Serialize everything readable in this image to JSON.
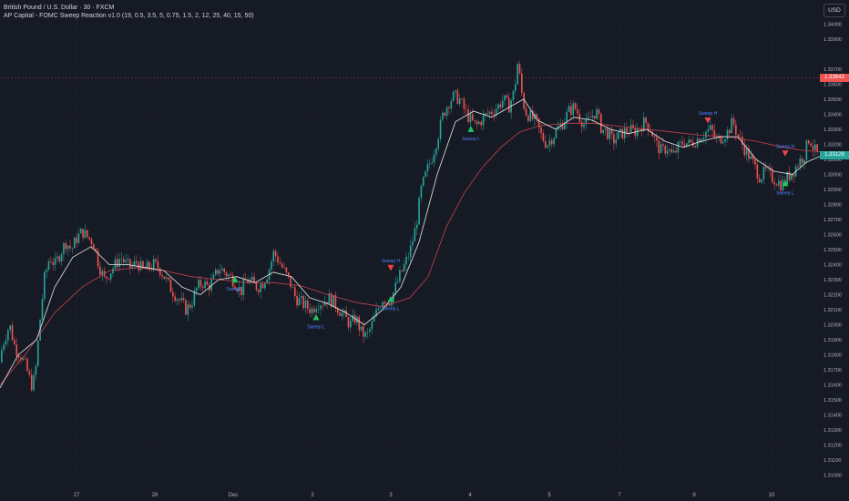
{
  "header": {
    "symbol": "British Pound / U.S. Dollar · 30 · FXCM",
    "indicator": "AP Capital - FOMC Sweep Reaction v1.0 (19, 0.5, 3.5, 5, 0.75, 1.5, 2, 12, 25, 40, 15, 50)"
  },
  "currency_button": "USD",
  "colors": {
    "background": "#161a25",
    "up": "#26a69a",
    "down": "#ef5350",
    "fast_ma": "#e8e8e8",
    "slow_ma": "#c2424c",
    "sweep_label": "#4d82ff",
    "grid": "#1e222d"
  },
  "chart_data": {
    "type": "line",
    "y_ticks": [
      "1.34000",
      "1.33900",
      "1.33700",
      "1.33600",
      "1.33500",
      "1.33400",
      "1.33300",
      "1.33200",
      "1.33100",
      "1.33000",
      "1.32900",
      "1.32800",
      "1.32700",
      "1.32600",
      "1.32500",
      "1.32400",
      "1.32300",
      "1.32200",
      "1.32100",
      "1.32000",
      "1.31900",
      "1.31800",
      "1.31700",
      "1.31600",
      "1.31500",
      "1.31400",
      "1.31300",
      "1.31200",
      "1.31100",
      "1.31000"
    ],
    "ylim": [
      1.3095,
      1.3405
    ],
    "x_ticks": [
      "27",
      "28",
      "Dec",
      "2",
      "3",
      "4",
      "5",
      "7",
      "9",
      "10"
    ],
    "last_price": "1.33643",
    "last_price_value": 1.33643,
    "current_price": "1.33128",
    "current_price_value": 1.33128,
    "x_range": [
      0,
      900
    ],
    "price_path": [
      [
        0,
        1.3175
      ],
      [
        6,
        1.319
      ],
      [
        12,
        1.32
      ],
      [
        18,
        1.3185
      ],
      [
        24,
        1.318
      ],
      [
        30,
        1.3172
      ],
      [
        36,
        1.316
      ],
      [
        40,
        1.3165
      ],
      [
        45,
        1.32
      ],
      [
        50,
        1.323
      ],
      [
        56,
        1.3245
      ],
      [
        62,
        1.324
      ],
      [
        68,
        1.3248
      ],
      [
        74,
        1.3255
      ],
      [
        80,
        1.325
      ],
      [
        86,
        1.3258
      ],
      [
        92,
        1.3262
      ],
      [
        98,
        1.3258
      ],
      [
        104,
        1.3255
      ],
      [
        110,
        1.324
      ],
      [
        116,
        1.323
      ],
      [
        122,
        1.3235
      ],
      [
        128,
        1.324
      ],
      [
        134,
        1.3245
      ],
      [
        140,
        1.324
      ],
      [
        146,
        1.3238
      ],
      [
        152,
        1.3242
      ],
      [
        158,
        1.3236
      ],
      [
        164,
        1.3238
      ],
      [
        170,
        1.324
      ],
      [
        176,
        1.3238
      ],
      [
        182,
        1.3232
      ],
      [
        188,
        1.3225
      ],
      [
        194,
        1.322
      ],
      [
        200,
        1.3215
      ],
      [
        206,
        1.321
      ],
      [
        212,
        1.3215
      ],
      [
        218,
        1.3225
      ],
      [
        224,
        1.3228
      ],
      [
        230,
        1.3225
      ],
      [
        236,
        1.323
      ],
      [
        242,
        1.3238
      ],
      [
        248,
        1.3235
      ],
      [
        254,
        1.3232
      ],
      [
        260,
        1.3228
      ],
      [
        266,
        1.3222
      ],
      [
        272,
        1.323
      ],
      [
        278,
        1.3228
      ],
      [
        284,
        1.3225
      ],
      [
        290,
        1.3228
      ],
      [
        296,
        1.3235
      ],
      [
        302,
        1.3248
      ],
      [
        308,
        1.3242
      ],
      [
        314,
        1.3235
      ],
      [
        320,
        1.3228
      ],
      [
        326,
        1.3218
      ],
      [
        332,
        1.3215
      ],
      [
        338,
        1.3212
      ],
      [
        344,
        1.321
      ],
      [
        350,
        1.3215
      ],
      [
        356,
        1.3215
      ],
      [
        362,
        1.3218
      ],
      [
        368,
        1.3215
      ],
      [
        374,
        1.321
      ],
      [
        380,
        1.3205
      ],
      [
        386,
        1.32
      ],
      [
        392,
        1.3205
      ],
      [
        398,
        1.3195
      ],
      [
        404,
        1.3192
      ],
      [
        410,
        1.32
      ],
      [
        416,
        1.321
      ],
      [
        422,
        1.3218
      ],
      [
        428,
        1.3215
      ],
      [
        434,
        1.3222
      ],
      [
        440,
        1.3232
      ],
      [
        446,
        1.324
      ],
      [
        452,
        1.325
      ],
      [
        458,
        1.3265
      ],
      [
        464,
        1.329
      ],
      [
        470,
        1.3302
      ],
      [
        476,
        1.3312
      ],
      [
        482,
        1.3325
      ],
      [
        488,
        1.334
      ],
      [
        494,
        1.3348
      ],
      [
        500,
        1.3352
      ],
      [
        506,
        1.335
      ],
      [
        512,
        1.3342
      ],
      [
        518,
        1.3336
      ],
      [
        524,
        1.3332
      ],
      [
        530,
        1.3336
      ],
      [
        536,
        1.334
      ],
      [
        542,
        1.3342
      ],
      [
        548,
        1.3345
      ],
      [
        554,
        1.335
      ],
      [
        560,
        1.3345
      ],
      [
        566,
        1.3355
      ],
      [
        570,
        1.3375
      ],
      [
        574,
        1.3355
      ],
      [
        578,
        1.3342
      ],
      [
        584,
        1.3338
      ],
      [
        590,
        1.3335
      ],
      [
        596,
        1.3325
      ],
      [
        602,
        1.332
      ],
      [
        608,
        1.3325
      ],
      [
        614,
        1.333
      ],
      [
        620,
        1.3335
      ],
      [
        626,
        1.3342
      ],
      [
        632,
        1.3345
      ],
      [
        638,
        1.3338
      ],
      [
        644,
        1.3332
      ],
      [
        650,
        1.3338
      ],
      [
        656,
        1.3342
      ],
      [
        662,
        1.333
      ],
      [
        668,
        1.3328
      ],
      [
        674,
        1.3322
      ],
      [
        680,
        1.3325
      ],
      [
        686,
        1.3328
      ],
      [
        692,
        1.333
      ],
      [
        698,
        1.3328
      ],
      [
        704,
        1.3332
      ],
      [
        710,
        1.3335
      ],
      [
        716,
        1.333
      ],
      [
        722,
        1.332
      ],
      [
        728,
        1.3315
      ],
      [
        734,
        1.3318
      ],
      [
        740,
        1.3312
      ],
      [
        746,
        1.3318
      ],
      [
        752,
        1.3322
      ],
      [
        758,
        1.332
      ],
      [
        764,
        1.3322
      ],
      [
        770,
        1.3325
      ],
      [
        776,
        1.3328
      ],
      [
        782,
        1.333
      ],
      [
        788,
        1.3322
      ],
      [
        794,
        1.3325
      ],
      [
        800,
        1.3328
      ],
      [
        806,
        1.3335
      ],
      [
        812,
        1.3325
      ],
      [
        818,
        1.3318
      ],
      [
        824,
        1.3312
      ],
      [
        830,
        1.3305
      ],
      [
        836,
        1.3298
      ],
      [
        842,
        1.3302
      ],
      [
        848,
        1.3298
      ],
      [
        854,
        1.3296
      ],
      [
        860,
        1.3293
      ],
      [
        866,
        1.3298
      ],
      [
        872,
        1.3302
      ],
      [
        878,
        1.3308
      ],
      [
        884,
        1.3312
      ],
      [
        890,
        1.3325
      ],
      [
        894,
        1.3318
      ],
      [
        900,
        1.3312
      ]
    ],
    "fast_ma": [
      [
        0,
        1.3158
      ],
      [
        20,
        1.318
      ],
      [
        40,
        1.319
      ],
      [
        60,
        1.3225
      ],
      [
        80,
        1.3245
      ],
      [
        100,
        1.3252
      ],
      [
        120,
        1.324
      ],
      [
        140,
        1.324
      ],
      [
        160,
        1.3238
      ],
      [
        180,
        1.3236
      ],
      [
        200,
        1.3225
      ],
      [
        220,
        1.322
      ],
      [
        240,
        1.323
      ],
      [
        260,
        1.3232
      ],
      [
        280,
        1.3228
      ],
      [
        300,
        1.3235
      ],
      [
        320,
        1.3232
      ],
      [
        340,
        1.3218
      ],
      [
        360,
        1.3214
      ],
      [
        380,
        1.3208
      ],
      [
        400,
        1.32
      ],
      [
        420,
        1.321
      ],
      [
        440,
        1.3225
      ],
      [
        460,
        1.3255
      ],
      [
        480,
        1.33
      ],
      [
        500,
        1.3335
      ],
      [
        520,
        1.3342
      ],
      [
        540,
        1.3338
      ],
      [
        560,
        1.3345
      ],
      [
        575,
        1.335
      ],
      [
        590,
        1.3336
      ],
      [
        610,
        1.333
      ],
      [
        630,
        1.3338
      ],
      [
        650,
        1.3336
      ],
      [
        670,
        1.333
      ],
      [
        690,
        1.3327
      ],
      [
        710,
        1.333
      ],
      [
        730,
        1.3322
      ],
      [
        750,
        1.3318
      ],
      [
        770,
        1.3322
      ],
      [
        790,
        1.3325
      ],
      [
        810,
        1.3325
      ],
      [
        830,
        1.331
      ],
      [
        850,
        1.3302
      ],
      [
        870,
        1.33
      ],
      [
        885,
        1.3308
      ],
      [
        900,
        1.3312
      ]
    ],
    "slow_ma": [
      [
        0,
        1.316
      ],
      [
        30,
        1.3182
      ],
      [
        60,
        1.3208
      ],
      [
        90,
        1.3225
      ],
      [
        120,
        1.3236
      ],
      [
        150,
        1.3238
      ],
      [
        180,
        1.3236
      ],
      [
        210,
        1.3232
      ],
      [
        240,
        1.323
      ],
      [
        270,
        1.3228
      ],
      [
        300,
        1.3228
      ],
      [
        330,
        1.3226
      ],
      [
        360,
        1.322
      ],
      [
        390,
        1.3215
      ],
      [
        420,
        1.3212
      ],
      [
        450,
        1.3218
      ],
      [
        470,
        1.3232
      ],
      [
        490,
        1.3265
      ],
      [
        510,
        1.3288
      ],
      [
        530,
        1.3305
      ],
      [
        550,
        1.3318
      ],
      [
        570,
        1.3328
      ],
      [
        590,
        1.3332
      ],
      [
        620,
        1.3334
      ],
      [
        650,
        1.3334
      ],
      [
        680,
        1.3332
      ],
      [
        710,
        1.333
      ],
      [
        740,
        1.3328
      ],
      [
        770,
        1.3326
      ],
      [
        800,
        1.3325
      ],
      [
        830,
        1.3322
      ],
      [
        860,
        1.3318
      ],
      [
        880,
        1.3316
      ],
      [
        900,
        1.3315
      ]
    ],
    "markers": [
      {
        "x": 258,
        "price": 1.323,
        "direction": "up",
        "label": "Sweep L"
      },
      {
        "x": 347,
        "price": 1.3205,
        "direction": "up",
        "label": "Sweep L"
      },
      {
        "x": 429,
        "price": 1.3217,
        "direction": "up",
        "label": "Sweep L"
      },
      {
        "x": 429,
        "price": 1.3238,
        "direction": "down",
        "label": "Sweep H"
      },
      {
        "x": 517,
        "price": 1.333,
        "direction": "up",
        "label": "Sweep L"
      },
      {
        "x": 777,
        "price": 1.3336,
        "direction": "down",
        "label": "Sweep H"
      },
      {
        "x": 862,
        "price": 1.3314,
        "direction": "down",
        "label": "Sweep H"
      },
      {
        "x": 862,
        "price": 1.3294,
        "direction": "up",
        "label": "Sweep L"
      }
    ]
  }
}
